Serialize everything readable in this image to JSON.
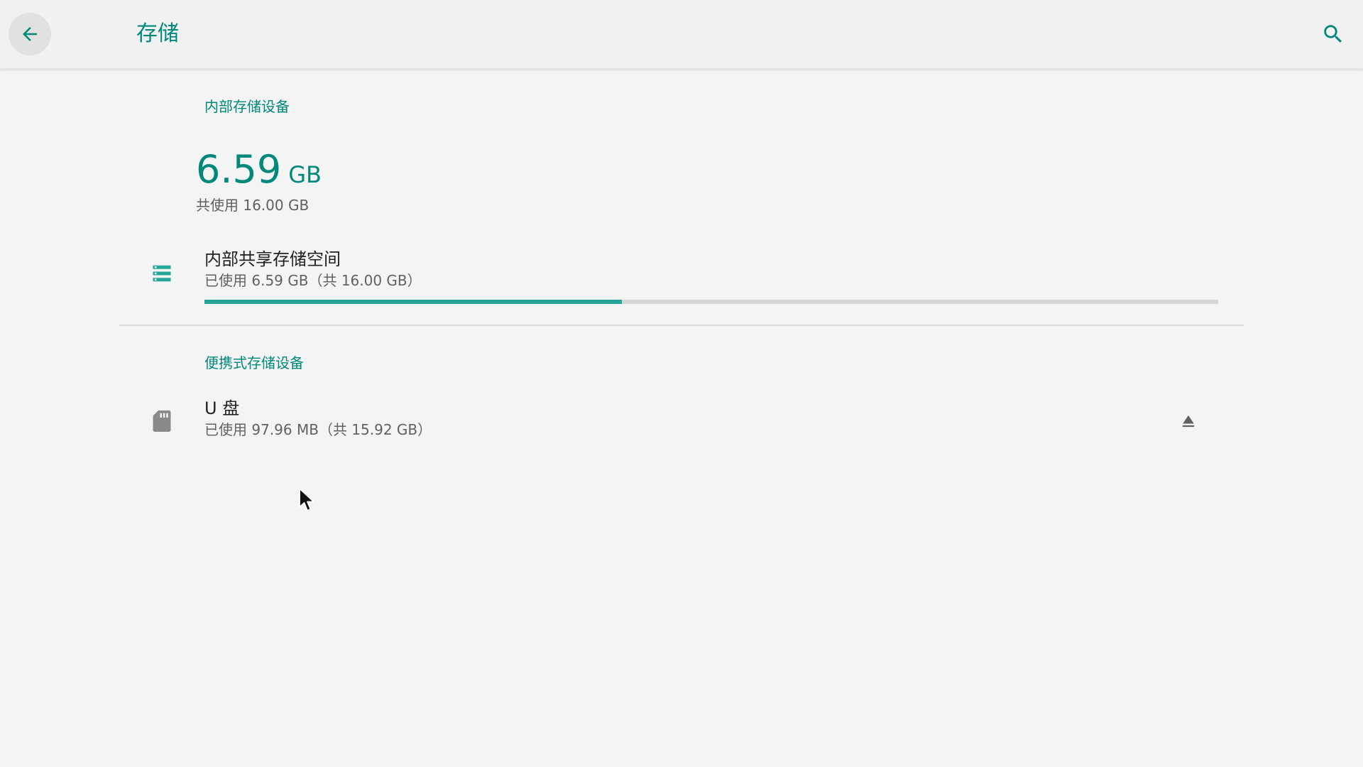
{
  "app_bar": {
    "title": "存储",
    "back_icon": "arrow-left-icon",
    "search_icon": "search-icon"
  },
  "internal_section": {
    "header": "内部存储设备",
    "used_value": "6.59",
    "used_unit": "GB",
    "total_text": "共使用 16.00 GB"
  },
  "shared_storage": {
    "icon": "storage-list-icon",
    "title": "内部共享存储空间",
    "summary": "已使用 6.59 GB（共 16.00 GB）",
    "used_fraction": 0.4119
  },
  "portable_section": {
    "header": "便携式存储设备"
  },
  "usb_drive": {
    "icon": "sd-card-icon",
    "title": "U 盘",
    "summary": "已使用 97.96 MB（共 15.92 GB）",
    "eject_icon": "eject-icon"
  },
  "colors": {
    "accent": "#00897b",
    "progress": "#26a69a",
    "track": "#d6d6d6",
    "background": "#f4f4f4",
    "icon_gray": "#8a8a8a"
  }
}
